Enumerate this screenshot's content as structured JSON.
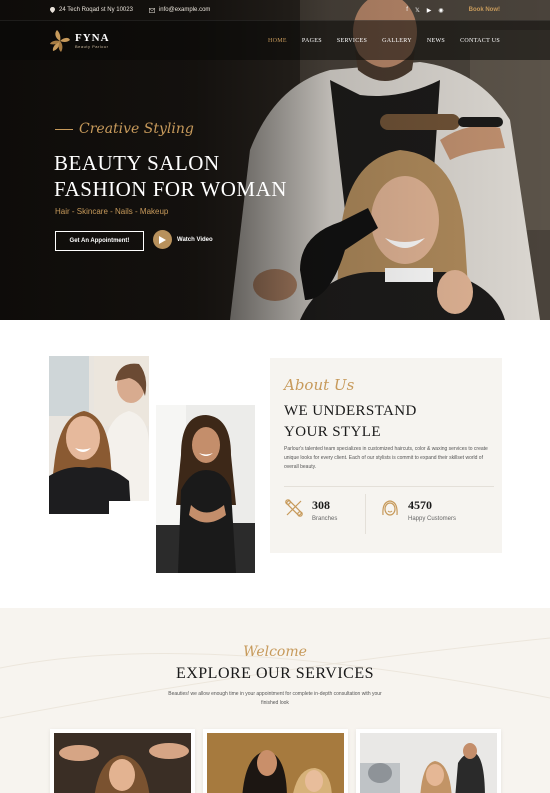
{
  "topbar": {
    "address": "24 Tech Roqad st Ny 10023",
    "email": "info@example.com",
    "book": "Book Now!",
    "social_icons": [
      "facebook-icon",
      "twitter-icon",
      "youtube-icon",
      "instagram-icon"
    ]
  },
  "brand": {
    "name": "FYNA",
    "tagline": "Beauty Parlour"
  },
  "nav": {
    "items": [
      "HOME",
      "PAGES",
      "SERVICES",
      "GALLERY",
      "NEWS",
      "CONTACT US"
    ],
    "active": "HOME"
  },
  "hero": {
    "script": "Creative Styling",
    "title_line1": "BEAUTY SALON",
    "title_line2": "FASHION FOR WOMAN",
    "categories": "Hair - Skincare - Nails - Makeup",
    "cta_label": "Get An Appointment!",
    "video_label": "Watch Video"
  },
  "about": {
    "script": "About Us",
    "title_line1": "WE UNDERSTAND",
    "title_line2": "YOUR STYLE",
    "text": "Parlour's talented team specializes in customized haircuts, color & waxing services to create unique looks for every client. Each of our stylists is commit to expand their skillset world of overall beauty.",
    "stats": [
      {
        "value": "308",
        "label": "Branches",
        "icon": "scissors-comb-icon"
      },
      {
        "value": "4570",
        "label": "Happy Customers",
        "icon": "woman-face-icon"
      }
    ]
  },
  "services": {
    "script": "Welcome",
    "title": "EXPLORE OUR SERVICES",
    "description": "Beauties! we allow enough time in your appointment for complete in-depth consultation with your finished look"
  },
  "colors": {
    "accent": "#c79a5b",
    "dark": "#171512",
    "card_bg": "#f6f4f0",
    "section_bg": "#f7f4ef"
  }
}
